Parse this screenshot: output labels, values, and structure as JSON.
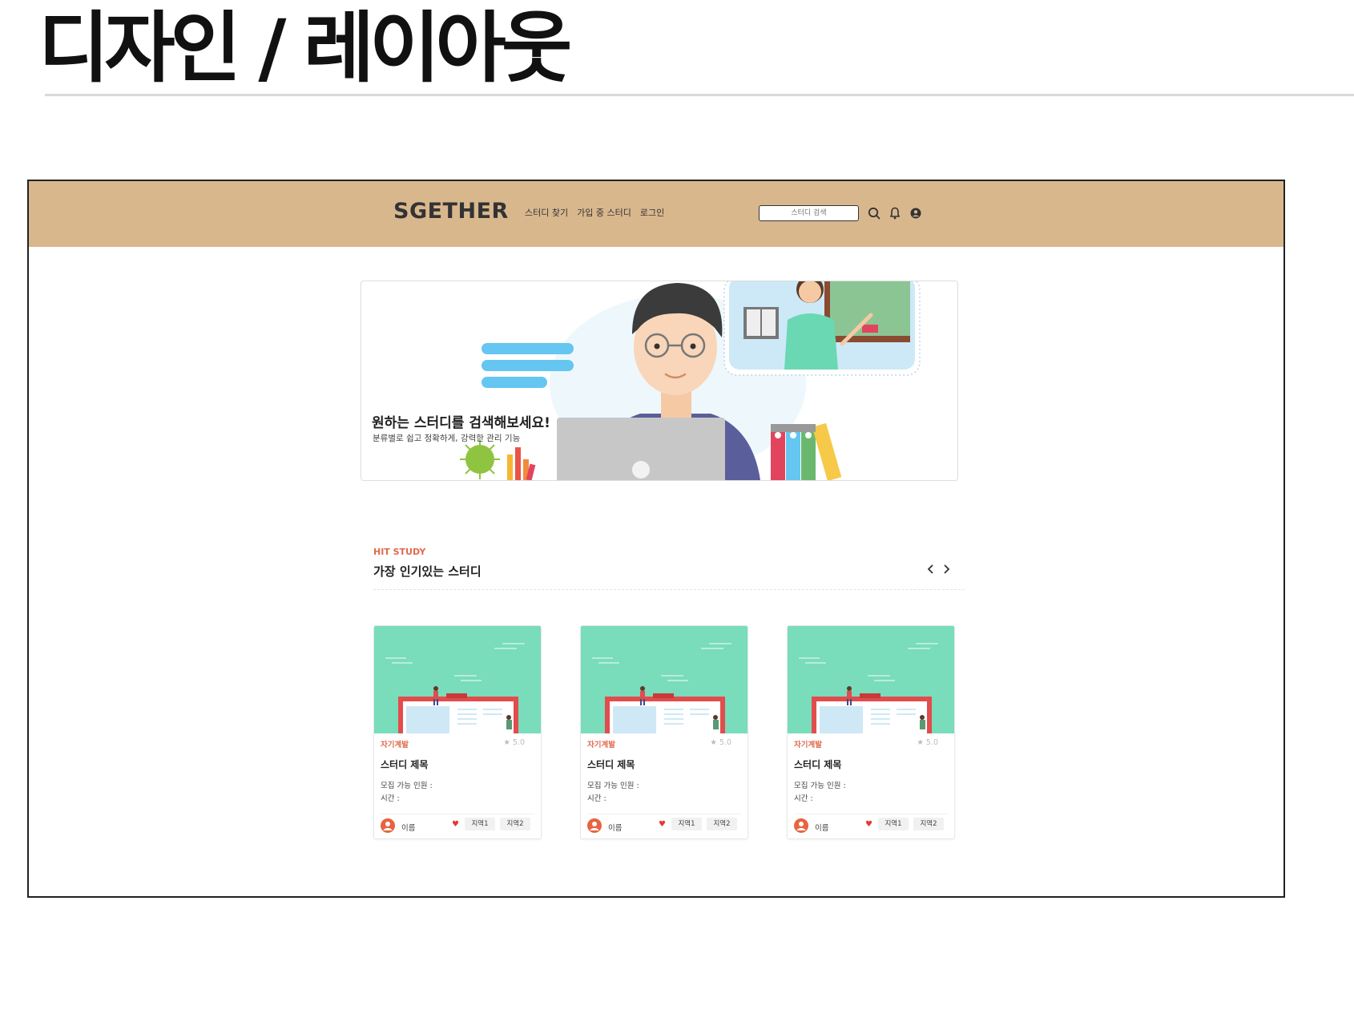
{
  "slide": {
    "title": "디자인 / 레이아웃"
  },
  "nav": {
    "logo": "SGETHER",
    "menu": [
      "스터디 찾기",
      "가입 중 스터디",
      "로그인"
    ],
    "search_placeholder": "스터디 검색",
    "icons": [
      "search-icon",
      "bell-icon",
      "user-icon"
    ],
    "background": "#d9b78d"
  },
  "banner": {
    "headline": "원하는 스터디를 검색해보세요!",
    "subtext": "분류별로 쉽고 정확하게, 강력한 관리 기능"
  },
  "section": {
    "eyebrow": "HIT STUDY",
    "title": "가장 인기있는 스터디",
    "prev_icon": "chevron-left-icon",
    "next_icon": "chevron-right-icon",
    "accent": "#e06a4e"
  },
  "cards": [
    {
      "category": "자기계발",
      "rating": "5.0",
      "title": "스터디 제목",
      "capacity_label": "모집 가능 인원 :",
      "time_label": "시간 :",
      "author": "이름",
      "tags": [
        "지역1",
        "지역2"
      ]
    },
    {
      "category": "자기계발",
      "rating": "5.0",
      "title": "스터디 제목",
      "capacity_label": "모집 가능 인원 :",
      "time_label": "시간 :",
      "author": "이름",
      "tags": [
        "지역1",
        "지역2"
      ]
    },
    {
      "category": "자기계발",
      "rating": "5.0",
      "title": "스터디 제목",
      "capacity_label": "모집 가능 인원 :",
      "time_label": "시간 :",
      "author": "이름",
      "tags": [
        "지역1",
        "지역2"
      ]
    }
  ]
}
